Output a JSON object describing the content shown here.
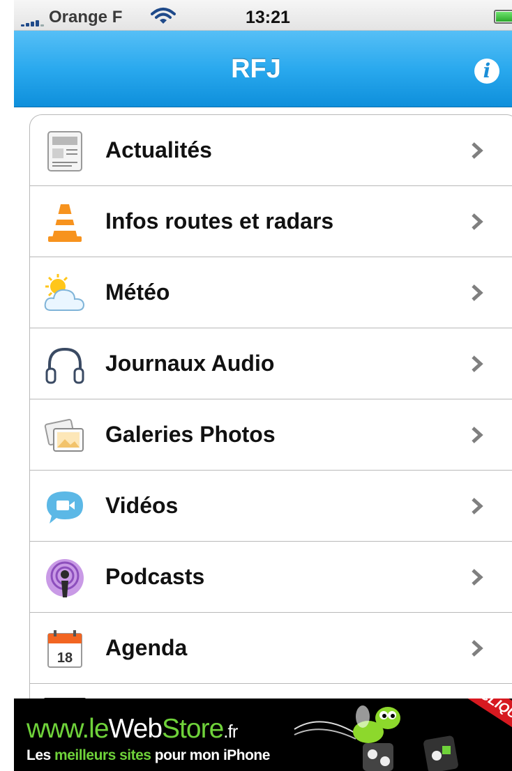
{
  "status_bar": {
    "carrier": "Orange F",
    "time": "13:21"
  },
  "nav_bar": {
    "title": "RFJ",
    "info_icon": "info-icon",
    "info_glyph": "i"
  },
  "menu": {
    "items": [
      {
        "label": "Actualités",
        "icon": "newspaper-icon"
      },
      {
        "label": "Infos routes et radars",
        "icon": "traffic-cone-icon"
      },
      {
        "label": "Météo",
        "icon": "weather-icon"
      },
      {
        "label": "Journaux Audio",
        "icon": "headphones-icon"
      },
      {
        "label": "Galeries Photos",
        "icon": "photos-icon"
      },
      {
        "label": "Vidéos",
        "icon": "video-bubble-icon"
      },
      {
        "label": "Podcasts",
        "icon": "podcast-icon"
      },
      {
        "label": "Agenda",
        "icon": "calendar-icon"
      }
    ],
    "calendar_day": "18",
    "chevron_icon": "chevron-right-icon"
  },
  "ad_banner": {
    "prefix": "www.le",
    "web": "Web",
    "store": "Store",
    "tld": ".fr",
    "tagline_start": "Les ",
    "tagline_highlight": "meilleurs sites",
    "tagline_end": " pour mon iPhone",
    "ribbon": "CLIQUE",
    "accent_color": "#6fd23a",
    "ribbon_color": "#d71920"
  }
}
